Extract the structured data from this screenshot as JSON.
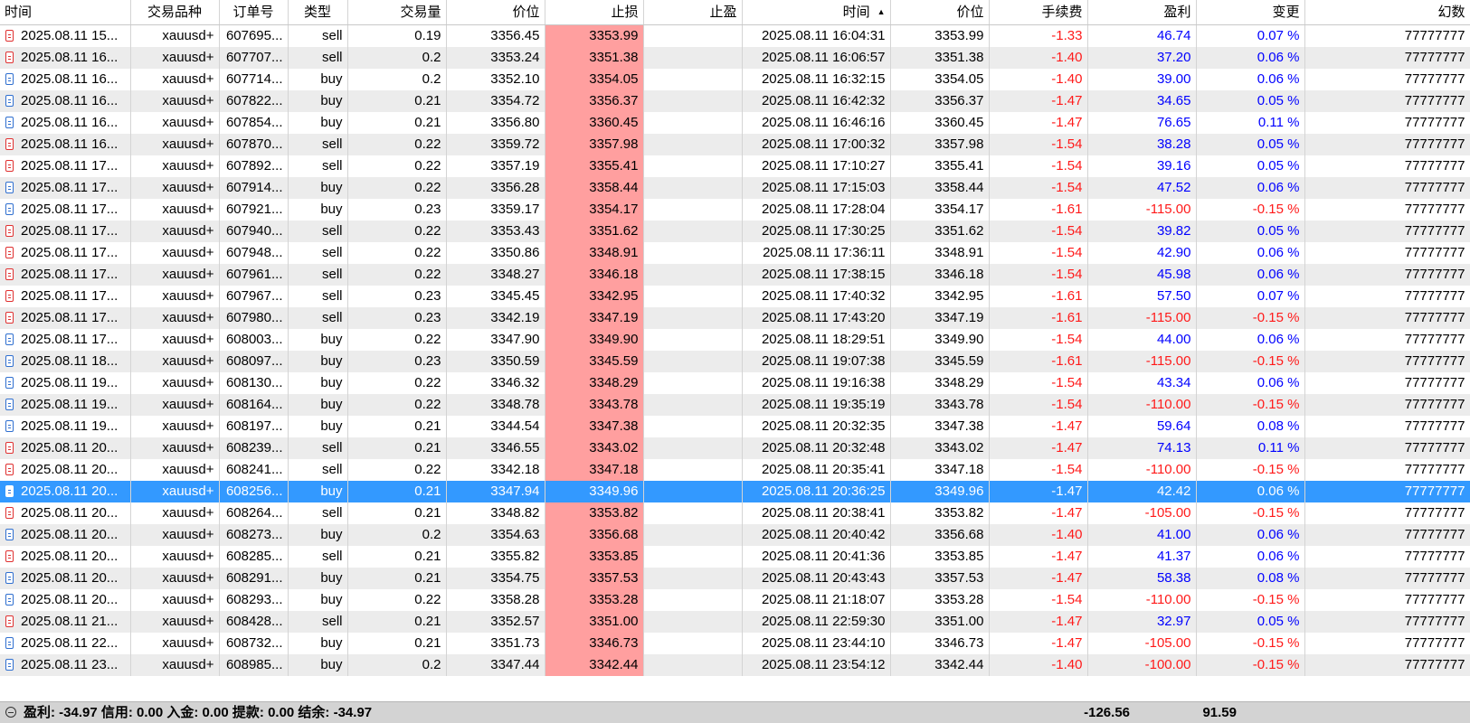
{
  "columns": [
    "时间",
    "交易品种",
    "订单号",
    "类型",
    "交易量",
    "价位",
    "止损",
    "止盈",
    "时间",
    "价位",
    "手续费",
    "盈利",
    "变更",
    "幻数"
  ],
  "rows": [
    {
      "open_time": "2025.08.11 15...",
      "symbol": "xauusd+",
      "order": "607695...",
      "type": "sell",
      "volume": "0.19",
      "price": "3356.45",
      "sl": "3353.99",
      "tp": "",
      "close_time": "2025.08.11 16:04:31",
      "close_price": "3353.99",
      "fee": "-1.33",
      "profit": "46.74",
      "change": "0.07 %",
      "magic": "77777777"
    },
    {
      "open_time": "2025.08.11 16...",
      "symbol": "xauusd+",
      "order": "607707...",
      "type": "sell",
      "volume": "0.2",
      "price": "3353.24",
      "sl": "3351.38",
      "tp": "",
      "close_time": "2025.08.11 16:06:57",
      "close_price": "3351.38",
      "fee": "-1.40",
      "profit": "37.20",
      "change": "0.06 %",
      "magic": "77777777"
    },
    {
      "open_time": "2025.08.11 16...",
      "symbol": "xauusd+",
      "order": "607714...",
      "type": "buy",
      "volume": "0.2",
      "price": "3352.10",
      "sl": "3354.05",
      "tp": "",
      "close_time": "2025.08.11 16:32:15",
      "close_price": "3354.05",
      "fee": "-1.40",
      "profit": "39.00",
      "change": "0.06 %",
      "magic": "77777777"
    },
    {
      "open_time": "2025.08.11 16...",
      "symbol": "xauusd+",
      "order": "607822...",
      "type": "buy",
      "volume": "0.21",
      "price": "3354.72",
      "sl": "3356.37",
      "tp": "",
      "close_time": "2025.08.11 16:42:32",
      "close_price": "3356.37",
      "fee": "-1.47",
      "profit": "34.65",
      "change": "0.05 %",
      "magic": "77777777"
    },
    {
      "open_time": "2025.08.11 16...",
      "symbol": "xauusd+",
      "order": "607854...",
      "type": "buy",
      "volume": "0.21",
      "price": "3356.80",
      "sl": "3360.45",
      "tp": "",
      "close_time": "2025.08.11 16:46:16",
      "close_price": "3360.45",
      "fee": "-1.47",
      "profit": "76.65",
      "change": "0.11 %",
      "magic": "77777777"
    },
    {
      "open_time": "2025.08.11 16...",
      "symbol": "xauusd+",
      "order": "607870...",
      "type": "sell",
      "volume": "0.22",
      "price": "3359.72",
      "sl": "3357.98",
      "tp": "",
      "close_time": "2025.08.11 17:00:32",
      "close_price": "3357.98",
      "fee": "-1.54",
      "profit": "38.28",
      "change": "0.05 %",
      "magic": "77777777"
    },
    {
      "open_time": "2025.08.11 17...",
      "symbol": "xauusd+",
      "order": "607892...",
      "type": "sell",
      "volume": "0.22",
      "price": "3357.19",
      "sl": "3355.41",
      "tp": "",
      "close_time": "2025.08.11 17:10:27",
      "close_price": "3355.41",
      "fee": "-1.54",
      "profit": "39.16",
      "change": "0.05 %",
      "magic": "77777777"
    },
    {
      "open_time": "2025.08.11 17...",
      "symbol": "xauusd+",
      "order": "607914...",
      "type": "buy",
      "volume": "0.22",
      "price": "3356.28",
      "sl": "3358.44",
      "tp": "",
      "close_time": "2025.08.11 17:15:03",
      "close_price": "3358.44",
      "fee": "-1.54",
      "profit": "47.52",
      "change": "0.06 %",
      "magic": "77777777"
    },
    {
      "open_time": "2025.08.11 17...",
      "symbol": "xauusd+",
      "order": "607921...",
      "type": "buy",
      "volume": "0.23",
      "price": "3359.17",
      "sl": "3354.17",
      "tp": "",
      "close_time": "2025.08.11 17:28:04",
      "close_price": "3354.17",
      "fee": "-1.61",
      "profit": "-115.00",
      "change": "-0.15 %",
      "magic": "77777777"
    },
    {
      "open_time": "2025.08.11 17...",
      "symbol": "xauusd+",
      "order": "607940...",
      "type": "sell",
      "volume": "0.22",
      "price": "3353.43",
      "sl": "3351.62",
      "tp": "",
      "close_time": "2025.08.11 17:30:25",
      "close_price": "3351.62",
      "fee": "-1.54",
      "profit": "39.82",
      "change": "0.05 %",
      "magic": "77777777"
    },
    {
      "open_time": "2025.08.11 17...",
      "symbol": "xauusd+",
      "order": "607948...",
      "type": "sell",
      "volume": "0.22",
      "price": "3350.86",
      "sl": "3348.91",
      "tp": "",
      "close_time": "2025.08.11 17:36:11",
      "close_price": "3348.91",
      "fee": "-1.54",
      "profit": "42.90",
      "change": "0.06 %",
      "magic": "77777777"
    },
    {
      "open_time": "2025.08.11 17...",
      "symbol": "xauusd+",
      "order": "607961...",
      "type": "sell",
      "volume": "0.22",
      "price": "3348.27",
      "sl": "3346.18",
      "tp": "",
      "close_time": "2025.08.11 17:38:15",
      "close_price": "3346.18",
      "fee": "-1.54",
      "profit": "45.98",
      "change": "0.06 %",
      "magic": "77777777"
    },
    {
      "open_time": "2025.08.11 17...",
      "symbol": "xauusd+",
      "order": "607967...",
      "type": "sell",
      "volume": "0.23",
      "price": "3345.45",
      "sl": "3342.95",
      "tp": "",
      "close_time": "2025.08.11 17:40:32",
      "close_price": "3342.95",
      "fee": "-1.61",
      "profit": "57.50",
      "change": "0.07 %",
      "magic": "77777777"
    },
    {
      "open_time": "2025.08.11 17...",
      "symbol": "xauusd+",
      "order": "607980...",
      "type": "sell",
      "volume": "0.23",
      "price": "3342.19",
      "sl": "3347.19",
      "tp": "",
      "close_time": "2025.08.11 17:43:20",
      "close_price": "3347.19",
      "fee": "-1.61",
      "profit": "-115.00",
      "change": "-0.15 %",
      "magic": "77777777"
    },
    {
      "open_time": "2025.08.11 17...",
      "symbol": "xauusd+",
      "order": "608003...",
      "type": "buy",
      "volume": "0.22",
      "price": "3347.90",
      "sl": "3349.90",
      "tp": "",
      "close_time": "2025.08.11 18:29:51",
      "close_price": "3349.90",
      "fee": "-1.54",
      "profit": "44.00",
      "change": "0.06 %",
      "magic": "77777777"
    },
    {
      "open_time": "2025.08.11 18...",
      "symbol": "xauusd+",
      "order": "608097...",
      "type": "buy",
      "volume": "0.23",
      "price": "3350.59",
      "sl": "3345.59",
      "tp": "",
      "close_time": "2025.08.11 19:07:38",
      "close_price": "3345.59",
      "fee": "-1.61",
      "profit": "-115.00",
      "change": "-0.15 %",
      "magic": "77777777"
    },
    {
      "open_time": "2025.08.11 19...",
      "symbol": "xauusd+",
      "order": "608130...",
      "type": "buy",
      "volume": "0.22",
      "price": "3346.32",
      "sl": "3348.29",
      "tp": "",
      "close_time": "2025.08.11 19:16:38",
      "close_price": "3348.29",
      "fee": "-1.54",
      "profit": "43.34",
      "change": "0.06 %",
      "magic": "77777777"
    },
    {
      "open_time": "2025.08.11 19...",
      "symbol": "xauusd+",
      "order": "608164...",
      "type": "buy",
      "volume": "0.22",
      "price": "3348.78",
      "sl": "3343.78",
      "tp": "",
      "close_time": "2025.08.11 19:35:19",
      "close_price": "3343.78",
      "fee": "-1.54",
      "profit": "-110.00",
      "change": "-0.15 %",
      "magic": "77777777"
    },
    {
      "open_time": "2025.08.11 19...",
      "symbol": "xauusd+",
      "order": "608197...",
      "type": "buy",
      "volume": "0.21",
      "price": "3344.54",
      "sl": "3347.38",
      "tp": "",
      "close_time": "2025.08.11 20:32:35",
      "close_price": "3347.38",
      "fee": "-1.47",
      "profit": "59.64",
      "change": "0.08 %",
      "magic": "77777777"
    },
    {
      "open_time": "2025.08.11 20...",
      "symbol": "xauusd+",
      "order": "608239...",
      "type": "sell",
      "volume": "0.21",
      "price": "3346.55",
      "sl": "3343.02",
      "tp": "",
      "close_time": "2025.08.11 20:32:48",
      "close_price": "3343.02",
      "fee": "-1.47",
      "profit": "74.13",
      "change": "0.11 %",
      "magic": "77777777"
    },
    {
      "open_time": "2025.08.11 20...",
      "symbol": "xauusd+",
      "order": "608241...",
      "type": "sell",
      "volume": "0.22",
      "price": "3342.18",
      "sl": "3347.18",
      "tp": "",
      "close_time": "2025.08.11 20:35:41",
      "close_price": "3347.18",
      "fee": "-1.54",
      "profit": "-110.00",
      "change": "-0.15 %",
      "magic": "77777777"
    },
    {
      "open_time": "2025.08.11 20...",
      "symbol": "xauusd+",
      "order": "608256...",
      "type": "buy",
      "volume": "0.21",
      "price": "3347.94",
      "sl": "3349.96",
      "tp": "",
      "close_time": "2025.08.11 20:36:25",
      "close_price": "3349.96",
      "fee": "-1.47",
      "profit": "42.42",
      "change": "0.06 %",
      "magic": "77777777",
      "selected": true
    },
    {
      "open_time": "2025.08.11 20...",
      "symbol": "xauusd+",
      "order": "608264...",
      "type": "sell",
      "volume": "0.21",
      "price": "3348.82",
      "sl": "3353.82",
      "tp": "",
      "close_time": "2025.08.11 20:38:41",
      "close_price": "3353.82",
      "fee": "-1.47",
      "profit": "-105.00",
      "change": "-0.15 %",
      "magic": "77777777"
    },
    {
      "open_time": "2025.08.11 20...",
      "symbol": "xauusd+",
      "order": "608273...",
      "type": "buy",
      "volume": "0.2",
      "price": "3354.63",
      "sl": "3356.68",
      "tp": "",
      "close_time": "2025.08.11 20:40:42",
      "close_price": "3356.68",
      "fee": "-1.40",
      "profit": "41.00",
      "change": "0.06 %",
      "magic": "77777777"
    },
    {
      "open_time": "2025.08.11 20...",
      "symbol": "xauusd+",
      "order": "608285...",
      "type": "sell",
      "volume": "0.21",
      "price": "3355.82",
      "sl": "3353.85",
      "tp": "",
      "close_time": "2025.08.11 20:41:36",
      "close_price": "3353.85",
      "fee": "-1.47",
      "profit": "41.37",
      "change": "0.06 %",
      "magic": "77777777"
    },
    {
      "open_time": "2025.08.11 20...",
      "symbol": "xauusd+",
      "order": "608291...",
      "type": "buy",
      "volume": "0.21",
      "price": "3354.75",
      "sl": "3357.53",
      "tp": "",
      "close_time": "2025.08.11 20:43:43",
      "close_price": "3357.53",
      "fee": "-1.47",
      "profit": "58.38",
      "change": "0.08 %",
      "magic": "77777777"
    },
    {
      "open_time": "2025.08.11 20...",
      "symbol": "xauusd+",
      "order": "608293...",
      "type": "buy",
      "volume": "0.22",
      "price": "3358.28",
      "sl": "3353.28",
      "tp": "",
      "close_time": "2025.08.11 21:18:07",
      "close_price": "3353.28",
      "fee": "-1.54",
      "profit": "-110.00",
      "change": "-0.15 %",
      "magic": "77777777"
    },
    {
      "open_time": "2025.08.11 21...",
      "symbol": "xauusd+",
      "order": "608428...",
      "type": "sell",
      "volume": "0.21",
      "price": "3352.57",
      "sl": "3351.00",
      "tp": "",
      "close_time": "2025.08.11 22:59:30",
      "close_price": "3351.00",
      "fee": "-1.47",
      "profit": "32.97",
      "change": "0.05 %",
      "magic": "77777777"
    },
    {
      "open_time": "2025.08.11 22...",
      "symbol": "xauusd+",
      "order": "608732...",
      "type": "buy",
      "volume": "0.21",
      "price": "3351.73",
      "sl": "3346.73",
      "tp": "",
      "close_time": "2025.08.11 23:44:10",
      "close_price": "3346.73",
      "fee": "-1.47",
      "profit": "-105.00",
      "change": "-0.15 %",
      "magic": "77777777"
    },
    {
      "open_time": "2025.08.11 23...",
      "symbol": "xauusd+",
      "order": "608985...",
      "type": "buy",
      "volume": "0.2",
      "price": "3347.44",
      "sl": "3342.44",
      "tp": "",
      "close_time": "2025.08.11 23:54:12",
      "close_price": "3342.44",
      "fee": "-1.40",
      "profit": "-100.00",
      "change": "-0.15 %",
      "magic": "77777777"
    }
  ],
  "summary": {
    "text": "盈利: -34.97  信用: 0.00  入金: 0.00  提款: 0.00  结余: -34.97",
    "total_fee": "-126.56",
    "total_profit": "91.59"
  },
  "colors": {
    "stop_loss_bg": "#ff9f9f",
    "selected_row_bg": "#3399ff",
    "negative_text": "#ff1a1a",
    "positive_text": "#0000ff",
    "sell_icon": "#e03030",
    "buy_icon": "#2f6fd0"
  }
}
